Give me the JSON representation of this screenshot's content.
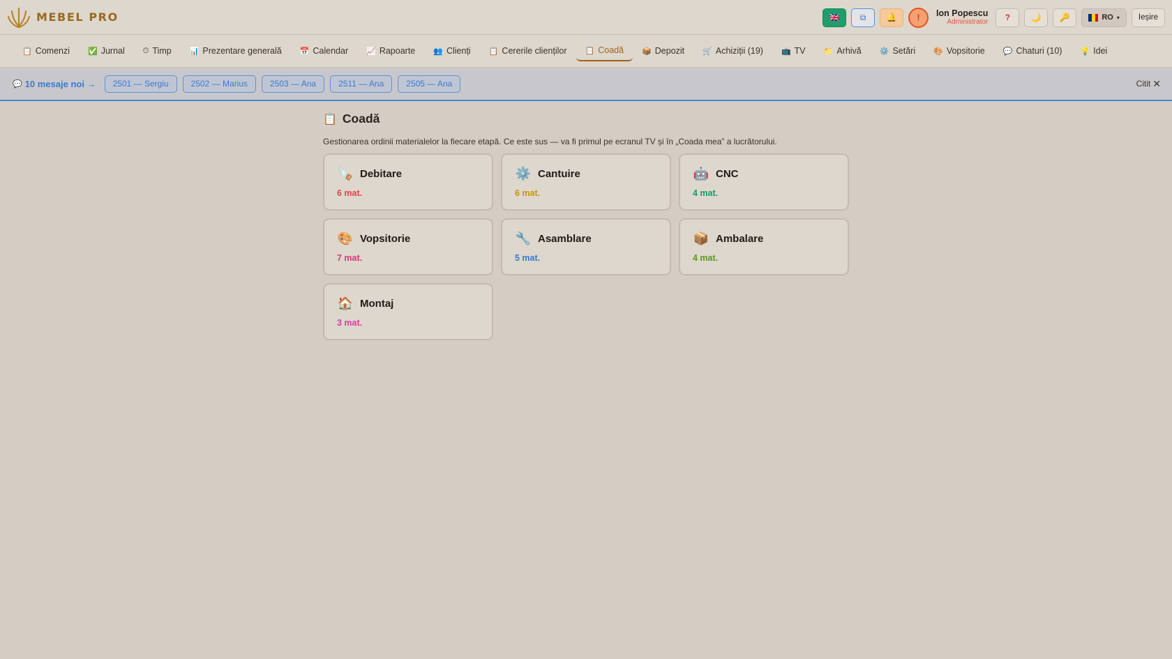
{
  "app": {
    "name": "MEBEL PRO"
  },
  "header": {
    "user_name": "Ion Popescu",
    "user_role": "Administrator",
    "lang": "RO",
    "logout": "Ieșire",
    "alert_glyph": "!",
    "help_glyph": "?"
  },
  "nav": [
    {
      "label": "Comenzi",
      "icon": "clipboard-icon"
    },
    {
      "label": "Jurnal",
      "icon": "check-icon"
    },
    {
      "label": "Timp",
      "icon": "stopwatch-icon"
    },
    {
      "label": "Prezentare generală",
      "icon": "bar-chart-icon"
    },
    {
      "label": "Calendar",
      "icon": "calendar-icon"
    },
    {
      "label": "Rapoarte",
      "icon": "line-chart-icon"
    },
    {
      "label": "Clienți",
      "icon": "users-icon"
    },
    {
      "label": "Cererile clienților",
      "icon": "clipboard-icon"
    },
    {
      "label": "Coadă",
      "icon": "clipboard-icon",
      "active": true
    },
    {
      "label": "Depozit",
      "icon": "box-icon"
    },
    {
      "label": "Achiziții (19)",
      "icon": "cart-icon"
    },
    {
      "label": "TV",
      "icon": "tv-icon"
    },
    {
      "label": "Arhivă",
      "icon": "folder-icon"
    },
    {
      "label": "Setări",
      "icon": "gear-icon"
    },
    {
      "label": "Vopsitorie",
      "icon": "palette-icon"
    },
    {
      "label": "Chaturi (10)",
      "icon": "chat-icon"
    },
    {
      "label": "Idei",
      "icon": "lightbulb-icon"
    }
  ],
  "messages": {
    "summary": "10 mesaje noi →",
    "chips": [
      "2501 — Sergiu",
      "2502 — Marius",
      "2503 — Ana",
      "2511 — Ana",
      "2505 — Ana"
    ],
    "read_label": "Citit"
  },
  "page": {
    "title": "Coadă",
    "description": "Gestionarea ordinii materialelor la fiecare etapă. Ce este sus — va fi primul pe ecranul TV și în „Coada mea” a lucrătorului."
  },
  "stages": [
    {
      "name": "Debitare",
      "count": "6 mat.",
      "color": "#e0444a",
      "icon": "saw-icon",
      "glyph": "🪚"
    },
    {
      "name": "Cantuire",
      "count": "6 mat.",
      "color": "#c8960e",
      "icon": "gear-icon",
      "glyph": "⚙️"
    },
    {
      "name": "CNC",
      "count": "4 mat.",
      "color": "#1a9a6c",
      "icon": "robot-icon",
      "glyph": "🤖"
    },
    {
      "name": "Vopsitorie",
      "count": "7 mat.",
      "color": "#d23a78",
      "icon": "palette-icon",
      "glyph": "🎨"
    },
    {
      "name": "Asamblare",
      "count": "5 mat.",
      "color": "#3c78d0",
      "icon": "wrench-icon",
      "glyph": "🔧"
    },
    {
      "name": "Ambalare",
      "count": "4 mat.",
      "color": "#5a9a18",
      "icon": "package-icon",
      "glyph": "📦"
    },
    {
      "name": "Montaj",
      "count": "3 mat.",
      "color": "#d83fa0",
      "icon": "house-icon",
      "glyph": "🏠"
    }
  ]
}
